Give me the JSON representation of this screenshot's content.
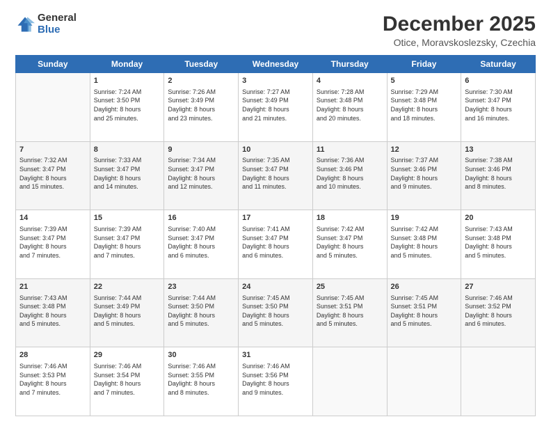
{
  "header": {
    "logo_general": "General",
    "logo_blue": "Blue",
    "month_title": "December 2025",
    "subtitle": "Otice, Moravskoslezsky, Czechia"
  },
  "weekdays": [
    "Sunday",
    "Monday",
    "Tuesday",
    "Wednesday",
    "Thursday",
    "Friday",
    "Saturday"
  ],
  "weeks": [
    [
      {
        "day": "",
        "info": ""
      },
      {
        "day": "1",
        "info": "Sunrise: 7:24 AM\nSunset: 3:50 PM\nDaylight: 8 hours\nand 25 minutes."
      },
      {
        "day": "2",
        "info": "Sunrise: 7:26 AM\nSunset: 3:49 PM\nDaylight: 8 hours\nand 23 minutes."
      },
      {
        "day": "3",
        "info": "Sunrise: 7:27 AM\nSunset: 3:49 PM\nDaylight: 8 hours\nand 21 minutes."
      },
      {
        "day": "4",
        "info": "Sunrise: 7:28 AM\nSunset: 3:48 PM\nDaylight: 8 hours\nand 20 minutes."
      },
      {
        "day": "5",
        "info": "Sunrise: 7:29 AM\nSunset: 3:48 PM\nDaylight: 8 hours\nand 18 minutes."
      },
      {
        "day": "6",
        "info": "Sunrise: 7:30 AM\nSunset: 3:47 PM\nDaylight: 8 hours\nand 16 minutes."
      }
    ],
    [
      {
        "day": "7",
        "info": "Sunrise: 7:32 AM\nSunset: 3:47 PM\nDaylight: 8 hours\nand 15 minutes."
      },
      {
        "day": "8",
        "info": "Sunrise: 7:33 AM\nSunset: 3:47 PM\nDaylight: 8 hours\nand 14 minutes."
      },
      {
        "day": "9",
        "info": "Sunrise: 7:34 AM\nSunset: 3:47 PM\nDaylight: 8 hours\nand 12 minutes."
      },
      {
        "day": "10",
        "info": "Sunrise: 7:35 AM\nSunset: 3:47 PM\nDaylight: 8 hours\nand 11 minutes."
      },
      {
        "day": "11",
        "info": "Sunrise: 7:36 AM\nSunset: 3:46 PM\nDaylight: 8 hours\nand 10 minutes."
      },
      {
        "day": "12",
        "info": "Sunrise: 7:37 AM\nSunset: 3:46 PM\nDaylight: 8 hours\nand 9 minutes."
      },
      {
        "day": "13",
        "info": "Sunrise: 7:38 AM\nSunset: 3:46 PM\nDaylight: 8 hours\nand 8 minutes."
      }
    ],
    [
      {
        "day": "14",
        "info": "Sunrise: 7:39 AM\nSunset: 3:47 PM\nDaylight: 8 hours\nand 7 minutes."
      },
      {
        "day": "15",
        "info": "Sunrise: 7:39 AM\nSunset: 3:47 PM\nDaylight: 8 hours\nand 7 minutes."
      },
      {
        "day": "16",
        "info": "Sunrise: 7:40 AM\nSunset: 3:47 PM\nDaylight: 8 hours\nand 6 minutes."
      },
      {
        "day": "17",
        "info": "Sunrise: 7:41 AM\nSunset: 3:47 PM\nDaylight: 8 hours\nand 6 minutes."
      },
      {
        "day": "18",
        "info": "Sunrise: 7:42 AM\nSunset: 3:47 PM\nDaylight: 8 hours\nand 5 minutes."
      },
      {
        "day": "19",
        "info": "Sunrise: 7:42 AM\nSunset: 3:48 PM\nDaylight: 8 hours\nand 5 minutes."
      },
      {
        "day": "20",
        "info": "Sunrise: 7:43 AM\nSunset: 3:48 PM\nDaylight: 8 hours\nand 5 minutes."
      }
    ],
    [
      {
        "day": "21",
        "info": "Sunrise: 7:43 AM\nSunset: 3:48 PM\nDaylight: 8 hours\nand 5 minutes."
      },
      {
        "day": "22",
        "info": "Sunrise: 7:44 AM\nSunset: 3:49 PM\nDaylight: 8 hours\nand 5 minutes."
      },
      {
        "day": "23",
        "info": "Sunrise: 7:44 AM\nSunset: 3:50 PM\nDaylight: 8 hours\nand 5 minutes."
      },
      {
        "day": "24",
        "info": "Sunrise: 7:45 AM\nSunset: 3:50 PM\nDaylight: 8 hours\nand 5 minutes."
      },
      {
        "day": "25",
        "info": "Sunrise: 7:45 AM\nSunset: 3:51 PM\nDaylight: 8 hours\nand 5 minutes."
      },
      {
        "day": "26",
        "info": "Sunrise: 7:45 AM\nSunset: 3:51 PM\nDaylight: 8 hours\nand 5 minutes."
      },
      {
        "day": "27",
        "info": "Sunrise: 7:46 AM\nSunset: 3:52 PM\nDaylight: 8 hours\nand 6 minutes."
      }
    ],
    [
      {
        "day": "28",
        "info": "Sunrise: 7:46 AM\nSunset: 3:53 PM\nDaylight: 8 hours\nand 7 minutes."
      },
      {
        "day": "29",
        "info": "Sunrise: 7:46 AM\nSunset: 3:54 PM\nDaylight: 8 hours\nand 7 minutes."
      },
      {
        "day": "30",
        "info": "Sunrise: 7:46 AM\nSunset: 3:55 PM\nDaylight: 8 hours\nand 8 minutes."
      },
      {
        "day": "31",
        "info": "Sunrise: 7:46 AM\nSunset: 3:56 PM\nDaylight: 8 hours\nand 9 minutes."
      },
      {
        "day": "",
        "info": ""
      },
      {
        "day": "",
        "info": ""
      },
      {
        "day": "",
        "info": ""
      }
    ]
  ]
}
